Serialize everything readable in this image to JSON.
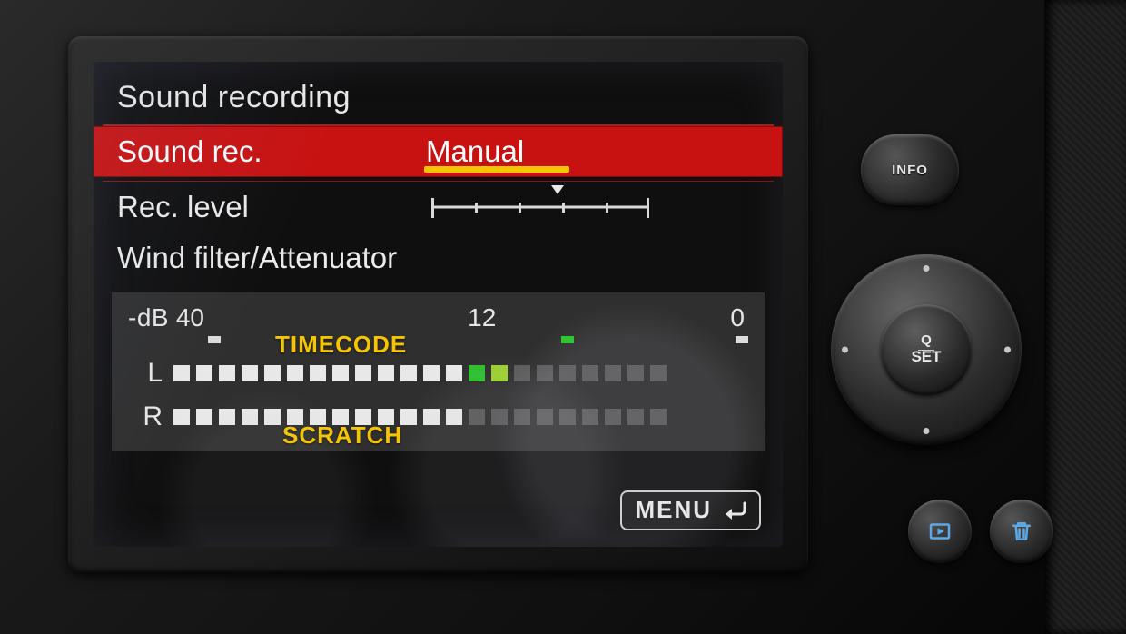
{
  "screen": {
    "title": "Sound recording",
    "rows": {
      "sound_rec": {
        "label": "Sound rec.",
        "value": "Manual"
      },
      "rec_level": {
        "label": "Rec. level",
        "marker_pct": 58
      },
      "wind": {
        "label": "Wind filter/Attenuator"
      }
    },
    "meter": {
      "scale_prefix": "-dB",
      "scale_40": "40",
      "scale_12": "12",
      "scale_0": "0",
      "channels": {
        "L": {
          "label": "L",
          "lit": 15,
          "green_at": 14,
          "ygreen_at": 15,
          "total": 22
        },
        "R": {
          "label": "R",
          "lit": 13,
          "total": 22
        }
      }
    },
    "menu_button": "MENU",
    "annotations": {
      "timecode": "TIMECODE",
      "scratch": "SCRATCH"
    }
  },
  "hardware": {
    "info": "INFO",
    "set_q": "Q",
    "set": "SET"
  }
}
